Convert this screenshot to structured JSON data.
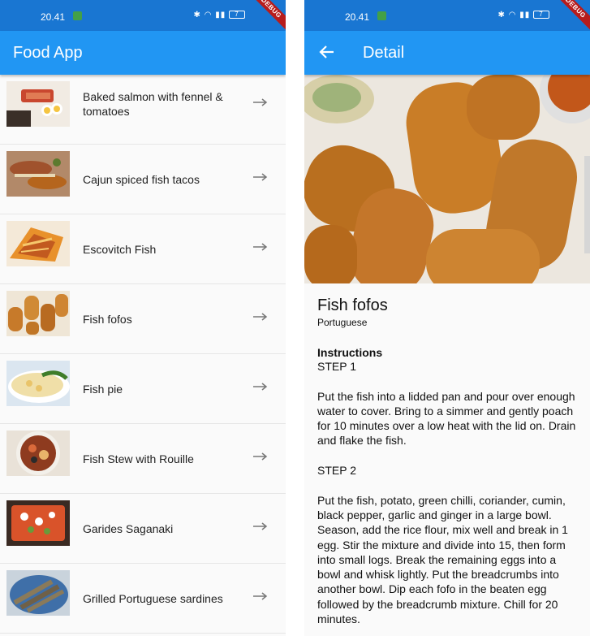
{
  "status_bar": {
    "time": "20.41",
    "battery": "7"
  },
  "debug_banner": "DEBUG",
  "list_screen": {
    "title": "Food App",
    "items": [
      {
        "label": "Baked salmon with fennel & tomatoes",
        "thumbnail": "salmon-plate"
      },
      {
        "label": "Cajun spiced fish tacos",
        "thumbnail": "fish-tacos"
      },
      {
        "label": "Escovitch Fish",
        "thumbnail": "escovitch-fish"
      },
      {
        "label": "Fish fofos",
        "thumbnail": "fish-croquettes"
      },
      {
        "label": "Fish pie",
        "thumbnail": "fish-pie"
      },
      {
        "label": "Fish Stew with Rouille",
        "thumbnail": "fish-stew"
      },
      {
        "label": "Garides Saganaki",
        "thumbnail": "shrimp-dish"
      },
      {
        "label": "Grilled Portuguese sardines",
        "thumbnail": "grilled-sardines"
      }
    ],
    "item_icon": "arrow-forward-icon"
  },
  "detail_screen": {
    "title": "Detail",
    "back_icon": "arrow-back-icon",
    "meal_name": "Fish fofos",
    "area": "Portuguese",
    "instructions_label": "Instructions",
    "instructions_text": "STEP 1\n\nPut the fish into a lidded pan and pour over enough water to cover. Bring to a simmer and gently poach for 10 minutes over a low heat with the lid on. Drain and flake the fish.\n\nSTEP 2\n\nPut the fish, potato, green chilli, coriander, cumin, black pepper, garlic and ginger in a large bowl. Season, add the rice flour, mix well and break in 1 egg. Stir the mixture and divide into 15, then form into small logs. Break the remaining eggs into a bowl and whisk lightly. Put the breadcrumbs into another bowl. Dip each fofo in the beaten egg followed by the breadcrumb mixture. Chill for 20 minutes."
  },
  "colors": {
    "status_bar": "#1976d2",
    "app_bar": "#2196f3",
    "debug_banner": "#b71c1c"
  }
}
